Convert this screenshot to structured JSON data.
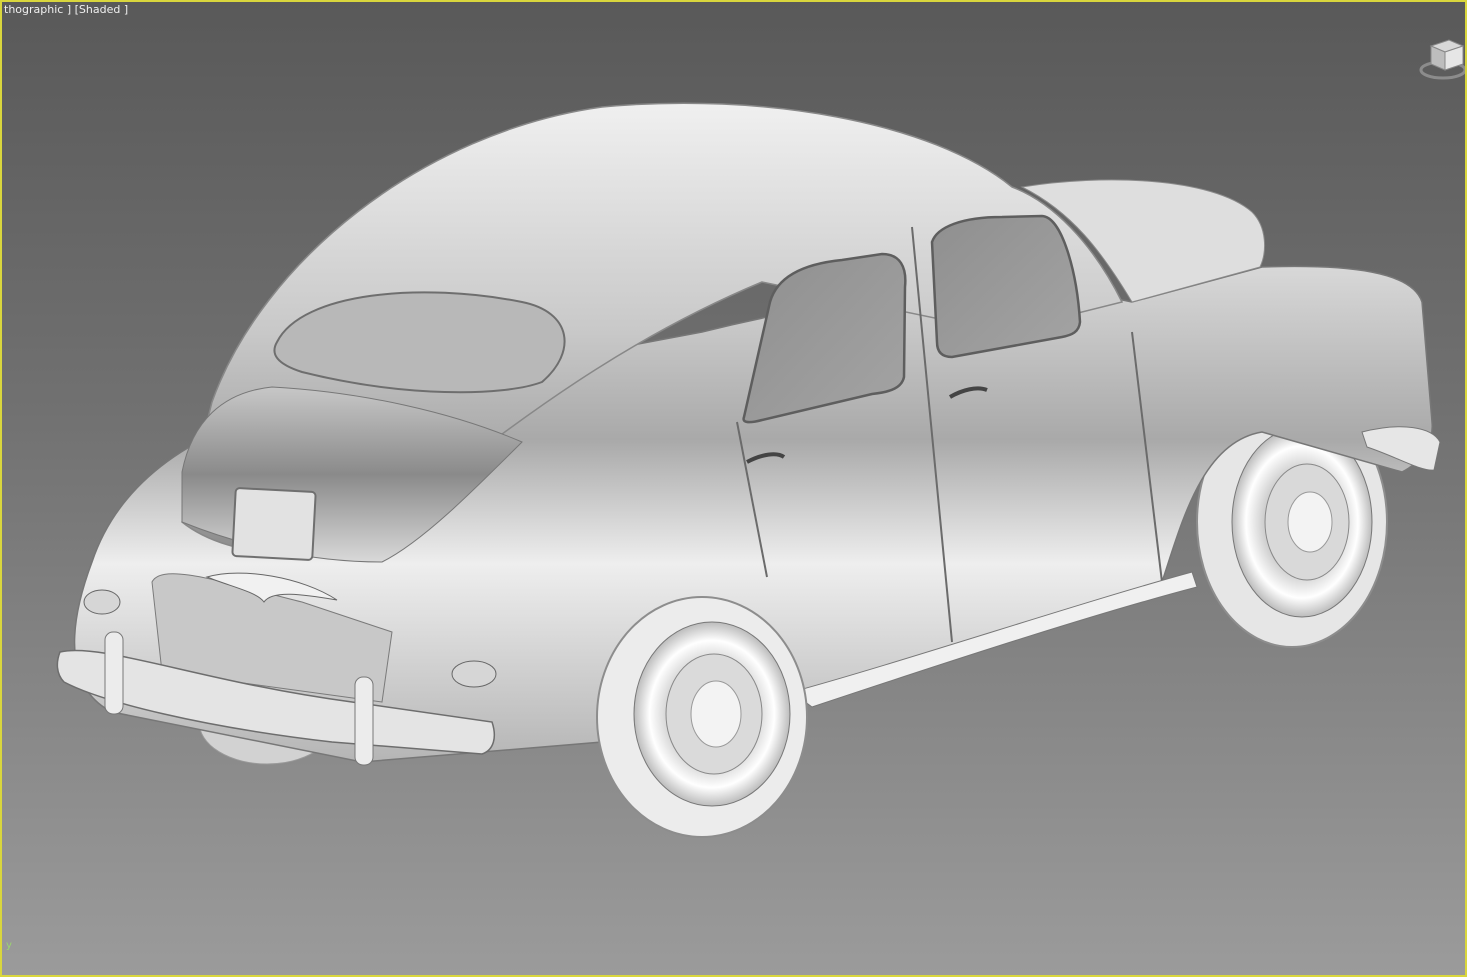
{
  "viewport": {
    "label": "thographic ] [Shaded ]",
    "axis_label": "y",
    "active_border_color": "#d9d63d",
    "background_top": "#595959",
    "background_bottom": "#9b9b9b"
  },
  "scene": {
    "object": "3d-car-model",
    "shading": "Shaded"
  },
  "viewcube": {
    "icon": "viewcube-icon"
  }
}
